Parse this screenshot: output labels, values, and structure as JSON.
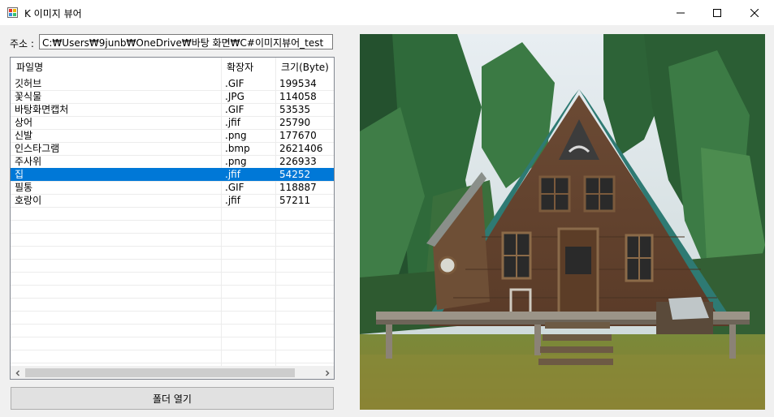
{
  "window": {
    "title": "K 이미지 뷰어",
    "icon": "app-icon",
    "controls": [
      "minimize-icon",
      "maximize-icon",
      "close-icon"
    ]
  },
  "address": {
    "label": "주소 :",
    "value": "C:₩Users₩9junb₩OneDrive₩바탕 화면₩C#이미지뷰어_test"
  },
  "file_list": {
    "columns": [
      "파일명",
      "확장자",
      "크기(Byte)"
    ],
    "rows": [
      {
        "name": "깃허브",
        "ext": ".GIF",
        "size": "199534"
      },
      {
        "name": "꽃식물",
        "ext": ".JPG",
        "size": "114058"
      },
      {
        "name": "바탕화면캡처",
        "ext": ".GIF",
        "size": "53535"
      },
      {
        "name": "상어",
        "ext": ".jfif",
        "size": "25790"
      },
      {
        "name": "신발",
        "ext": ".png",
        "size": "177670"
      },
      {
        "name": "인스타그램",
        "ext": ".bmp",
        "size": "2621406"
      },
      {
        "name": "주사위",
        "ext": ".png",
        "size": "226933"
      },
      {
        "name": "집",
        "ext": ".jfif",
        "size": "54252"
      },
      {
        "name": "필통",
        "ext": ".GIF",
        "size": "118887"
      },
      {
        "name": "호랑이",
        "ext": ".jfif",
        "size": "57211"
      }
    ],
    "selected_index": 7
  },
  "open_folder_button": {
    "label": "폴더 열기"
  },
  "colors": {
    "selection": "#0078d7",
    "window_bg": "#f0f0f0"
  }
}
